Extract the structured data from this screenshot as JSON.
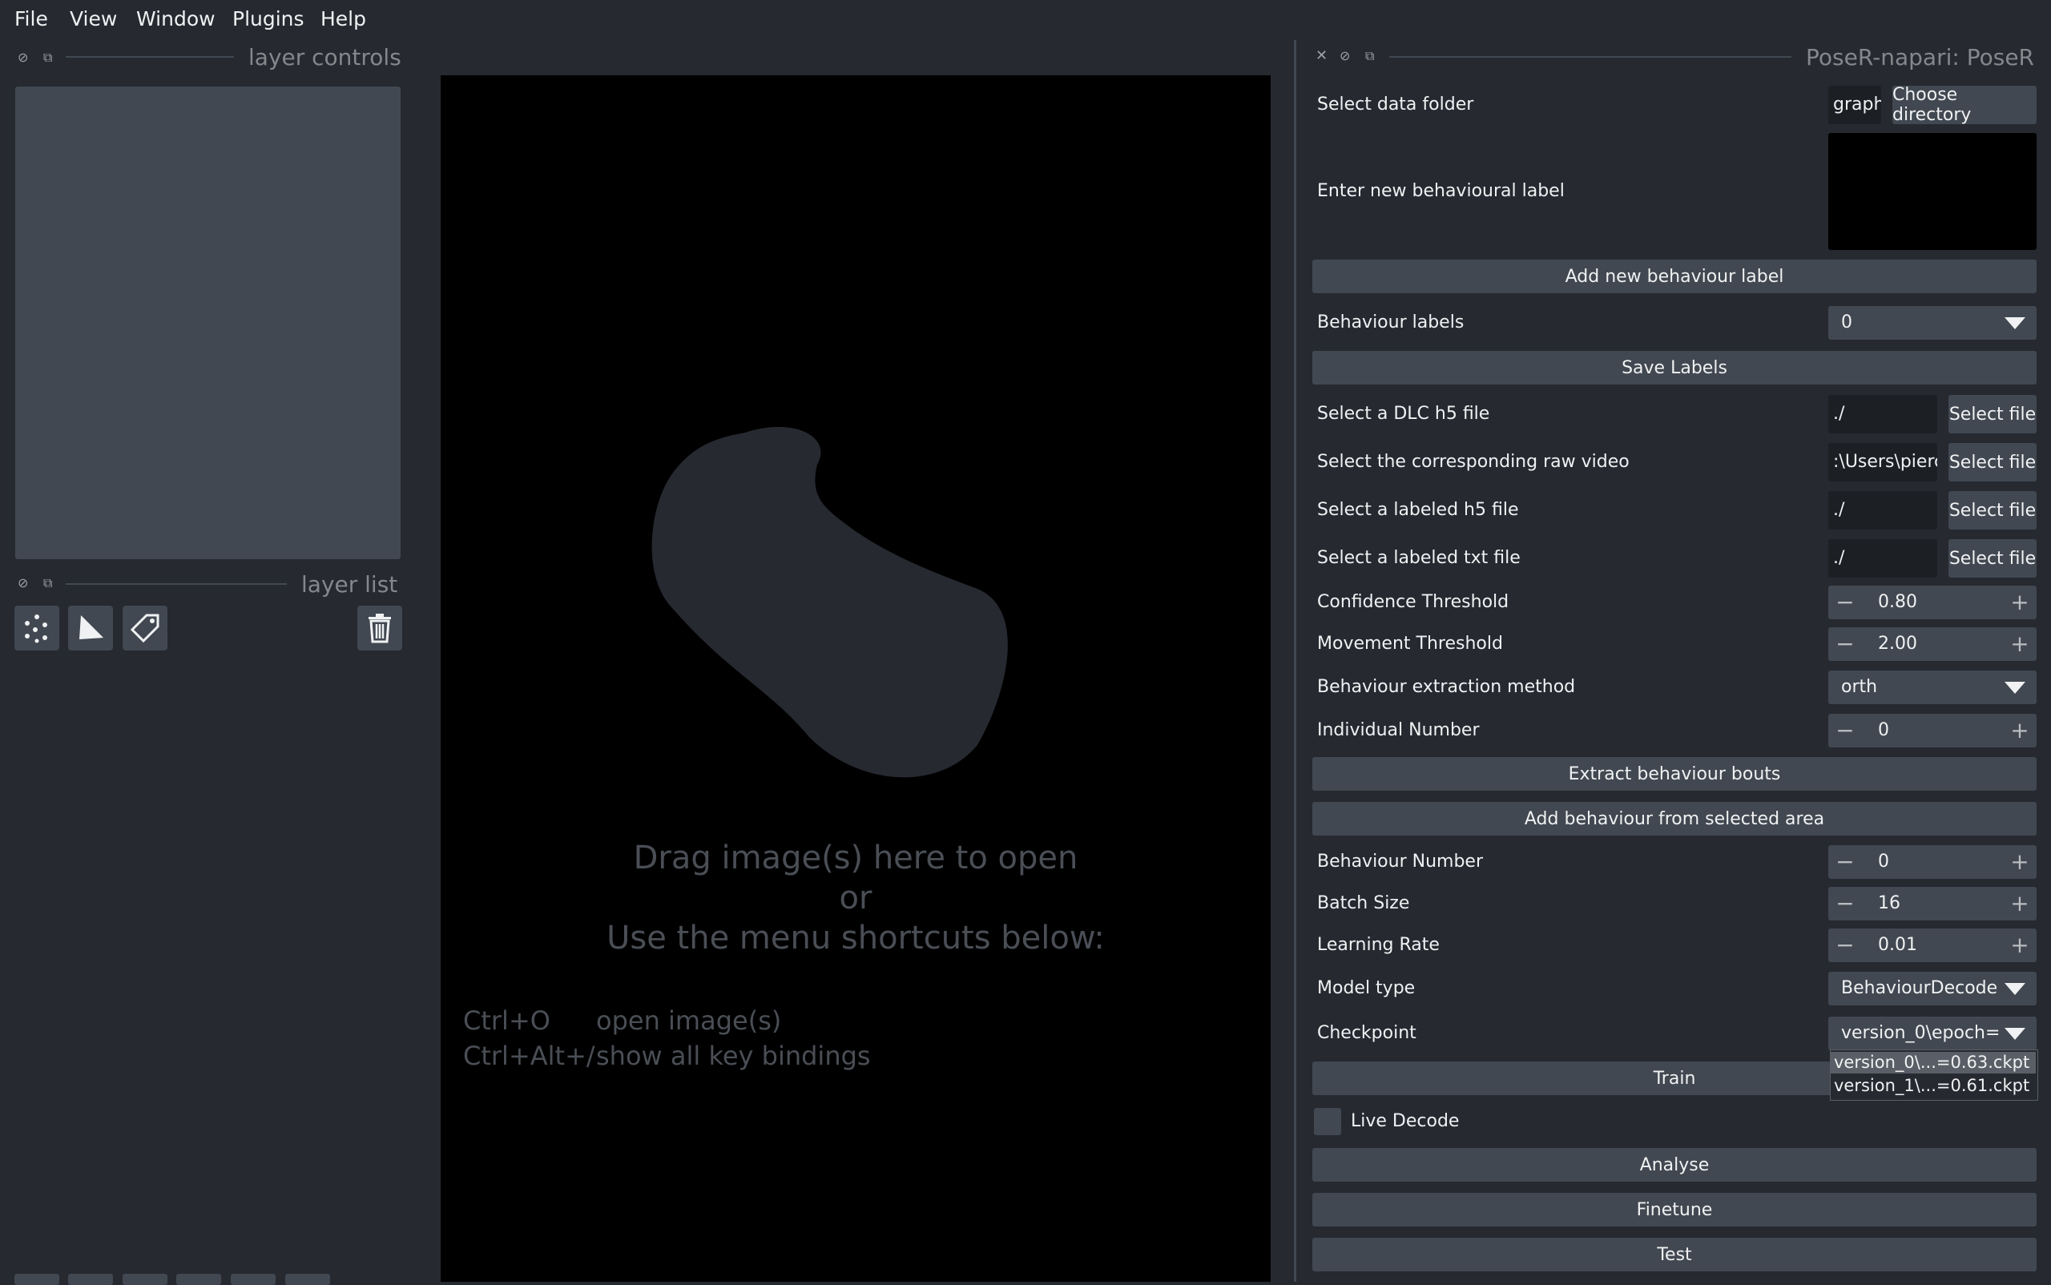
{
  "menubar": {
    "items": [
      "File",
      "View",
      "Window",
      "Plugins",
      "Help"
    ]
  },
  "left_panel": {
    "layer_controls_title": "layer controls",
    "layer_list_title": "layer list",
    "tools": [
      "points-icon",
      "shapes-icon",
      "labels-icon"
    ],
    "delete_icon": "trash-icon"
  },
  "canvas": {
    "welcome_lines": [
      "Drag image(s) here to open",
      "or",
      "Use the menu shortcuts below:"
    ],
    "shortcuts": [
      {
        "key": "Ctrl+O",
        "desc": "open image(s)"
      },
      {
        "key": "Ctrl+Alt+/",
        "desc": "show all key bindings"
      }
    ]
  },
  "plugin": {
    "title": "PoseR-napari: PoseR",
    "select_data_folder": {
      "label": "Select data folder",
      "value": "graph",
      "button": "Choose directory"
    },
    "new_label": {
      "label": "Enter new behavioural label",
      "value": ""
    },
    "add_label_button": "Add new behaviour label",
    "behaviour_labels": {
      "label": "Behaviour labels",
      "value": "0"
    },
    "save_labels_button": "Save Labels",
    "files": [
      {
        "label": "Select a DLC h5 file",
        "value": "./",
        "button": "Select file"
      },
      {
        "label": "Select the corresponding raw video",
        "value": ":\\Users\\pierc",
        "button": "Select file"
      },
      {
        "label": "Select a labeled h5 file",
        "value": "./",
        "button": "Select file"
      },
      {
        "label": "Select a labeled txt file",
        "value": "./",
        "button": "Select file"
      }
    ],
    "confidence_threshold": {
      "label": "Confidence Threshold",
      "value": "0.80"
    },
    "movement_threshold": {
      "label": "Movement Threshold",
      "value": "2.00"
    },
    "extraction_method": {
      "label": "Behaviour extraction method",
      "value": "orth"
    },
    "individual_number": {
      "label": "Individual Number",
      "value": "0"
    },
    "extract_button": "Extract behaviour bouts",
    "add_from_area_button": "Add behaviour from selected area",
    "behaviour_number": {
      "label": "Behaviour Number",
      "value": "0"
    },
    "batch_size": {
      "label": "Batch Size",
      "value": "16"
    },
    "learning_rate": {
      "label": "Learning Rate",
      "value": "0.01"
    },
    "model_type": {
      "label": "Model type",
      "value": "BehaviourDecode"
    },
    "checkpoint": {
      "label": "Checkpoint",
      "value": "version_0\\epoch=",
      "options": [
        "version_0\\...=0.63.ckpt",
        "version_1\\...=0.61.ckpt"
      ]
    },
    "train_button": "Train",
    "live_decode": {
      "label": "Live Decode",
      "checked": false
    },
    "analyse_button": "Analyse",
    "finetune_button": "Finetune",
    "test_button": "Test"
  },
  "colors": {
    "background": "#262930",
    "control": "#414851",
    "canvas": "#000000",
    "text": "#f0f1f2"
  }
}
